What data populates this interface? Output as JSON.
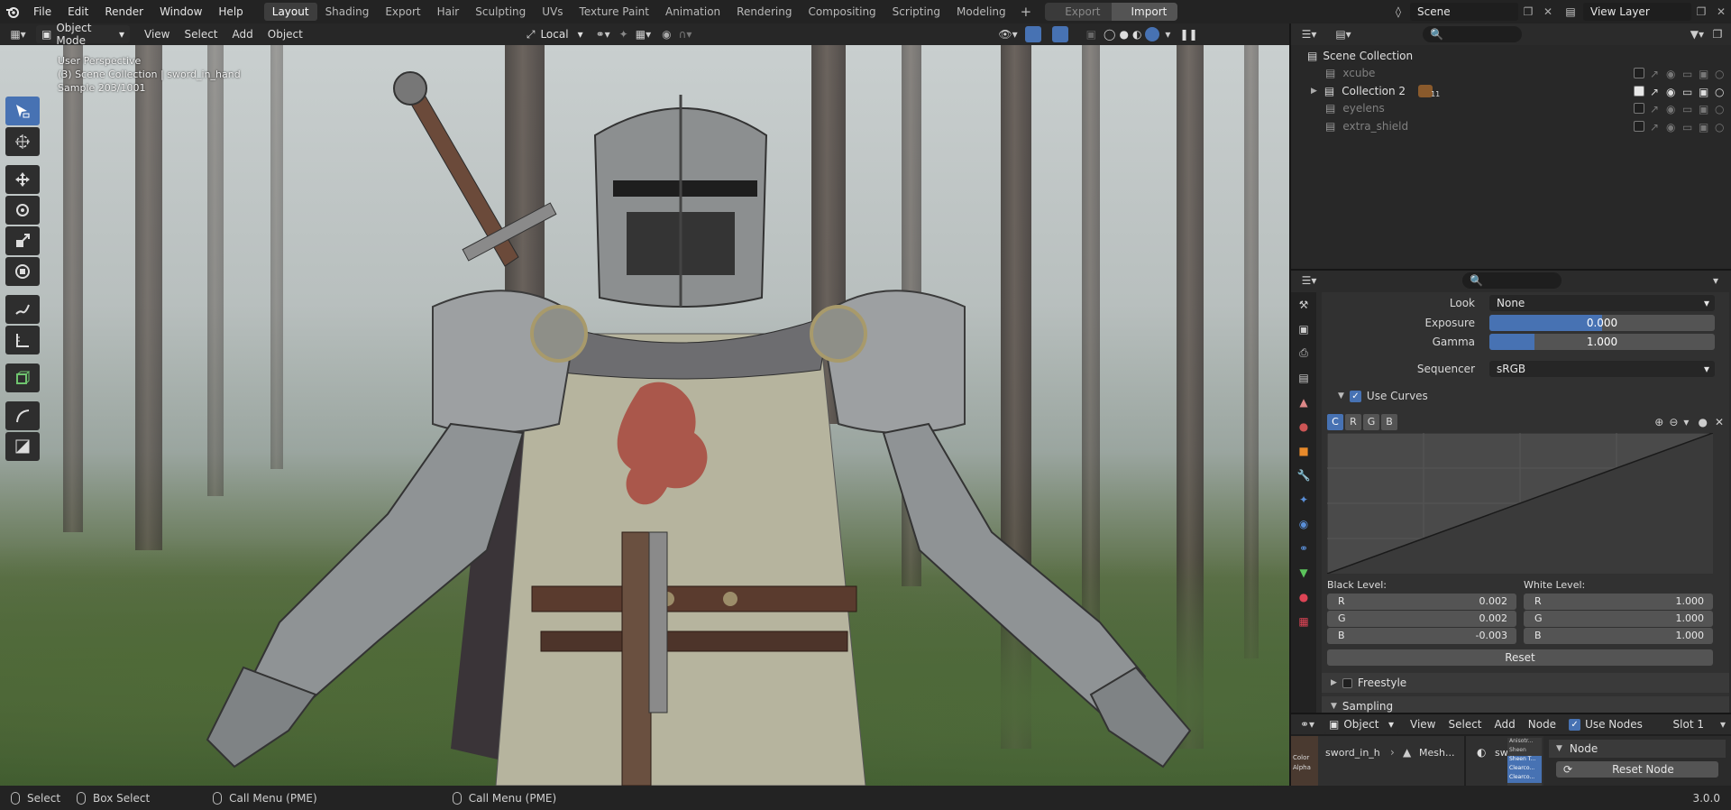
{
  "topbar": {
    "menus": [
      "File",
      "Edit",
      "Render",
      "Window",
      "Help"
    ],
    "workspaces": [
      "Layout",
      "Shading",
      "Export",
      "Hair",
      "Sculpting",
      "UVs",
      "Texture Paint",
      "Animation",
      "Rendering",
      "Compositing",
      "Scripting",
      "Modeling"
    ],
    "active_workspace": "Layout",
    "export_label": "Export",
    "import_label": "Import",
    "scene_label": "Scene",
    "view_layer_label": "View Layer"
  },
  "viewport": {
    "mode": "Object Mode",
    "menus": [
      "View",
      "Select",
      "Add",
      "Object"
    ],
    "transform_orientation": "Local",
    "overlay_line1": "User Perspective",
    "overlay_line2": "(3) Scene Collection | sword_in_hand",
    "overlay_line3": "Sample 203/1001"
  },
  "toolbar": {
    "tools": [
      "select-box-icon",
      "cursor-icon",
      "move-icon",
      "rotate-icon",
      "scale-icon",
      "transform-icon",
      "annotate-icon",
      "measure-icon",
      "add-cube-icon",
      "shear-icon",
      "scale-cage-icon"
    ]
  },
  "outliner": {
    "root": "Scene Collection",
    "rows": [
      {
        "label": "xcube",
        "dim": true
      },
      {
        "label": "Collection 2",
        "dim": false
      },
      {
        "label": "eyelens",
        "dim": true
      },
      {
        "label": "extra_shield",
        "dim": true
      }
    ],
    "badge_count": "11"
  },
  "properties": {
    "look_label": "Look",
    "look_value": "None",
    "exposure_label": "Exposure",
    "exposure_value": "0.000",
    "exposure_fill": 0.5,
    "gamma_label": "Gamma",
    "gamma_value": "1.000",
    "gamma_fill": 0.2,
    "sequencer_label": "Sequencer",
    "sequencer_value": "sRGB",
    "use_curves_label": "Use Curves",
    "curve_channels": [
      "C",
      "R",
      "G",
      "B"
    ],
    "black_level_label": "Black Level:",
    "white_level_label": "White Level:",
    "black_level": [
      {
        "ch": "R",
        "v": "0.002"
      },
      {
        "ch": "G",
        "v": "0.002"
      },
      {
        "ch": "B",
        "v": "-0.003"
      }
    ],
    "white_level": [
      {
        "ch": "R",
        "v": "1.000"
      },
      {
        "ch": "G",
        "v": "1.000"
      },
      {
        "ch": "B",
        "v": "1.000"
      }
    ],
    "reset_label": "Reset",
    "freestyle_label": "Freestyle",
    "sampling_label": "Sampling"
  },
  "node_editor": {
    "object_dropdown": "Object",
    "menus": [
      "View",
      "Select",
      "Add",
      "Node"
    ],
    "use_nodes_label": "Use Nodes",
    "slot_label": "Slot 1",
    "breadcrumb_object": "sword_in_h",
    "breadcrumb_mesh": "Mesh...",
    "breadcrumb_material": "sw...",
    "node_panel_title": "Node",
    "reset_node_label": "Reset Node",
    "socket_labels": [
      "Color",
      "Alpha"
    ],
    "mini_sockets": [
      "Anisotr...",
      "Sheen",
      "Sheen T...",
      "Clearco...",
      "Clearco..."
    ]
  },
  "statusbar": {
    "select_label": "Select",
    "box_select_label": "Box Select",
    "call_menu_1": "Call Menu (PME)",
    "call_menu_2": "Call Menu (PME)",
    "version": "3.0.0"
  },
  "colors": {
    "accent": "#4772b3",
    "panel_bg": "#313131",
    "header_bg": "#232323"
  }
}
